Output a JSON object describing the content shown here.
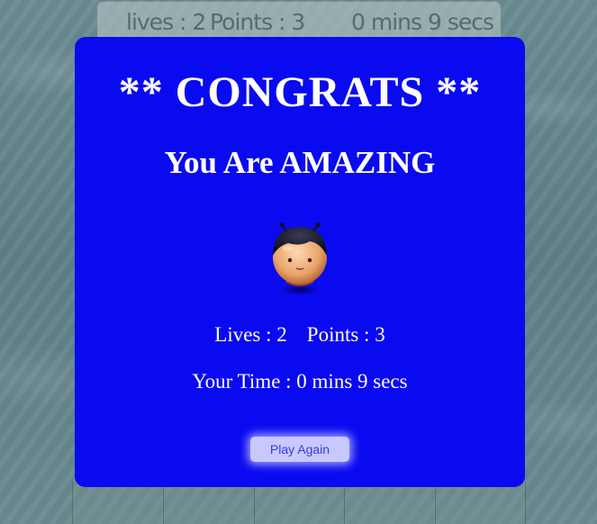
{
  "status_bar": {
    "lives": "lives : 2",
    "points": "Points : 3",
    "time": "0 mins 9 secs"
  },
  "modal": {
    "title": "** CONGRATS **",
    "subtitle": "You Are AMAZING",
    "avatar_icon": "character-icon",
    "lives": "Lives : 2",
    "points": "Points : 3",
    "time": "Your Time : 0 mins 9 secs",
    "play_again_label": "Play Again"
  },
  "colors": {
    "modal_background": "#0a0af0",
    "button_background": "#c8c8ff",
    "button_text": "#3a3ad8"
  }
}
